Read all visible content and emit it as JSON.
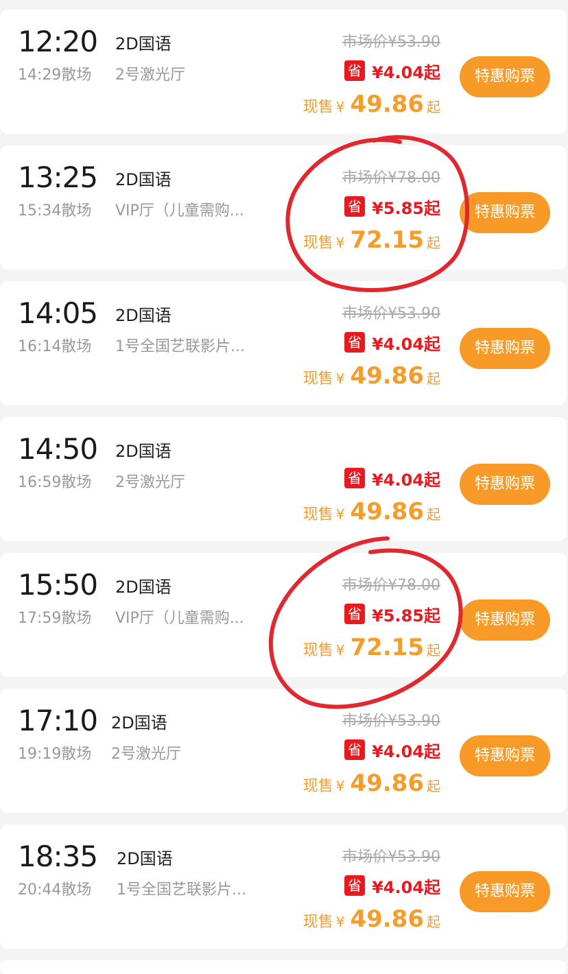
{
  "showtimes": [
    {
      "start": "12:20",
      "end": "14:29散场",
      "format": "2D国语",
      "hall": "2号激光厅",
      "market_price": "市场价¥53.90",
      "save_badge": "省",
      "save_amount": "¥4.04起",
      "now_label": "现售",
      "currency": "¥",
      "now_price": "49.86",
      "now_unit": "起",
      "button": "特惠购票"
    },
    {
      "start": "13:25",
      "end": "15:34散场",
      "format": "2D国语",
      "hall": "VIP厅（儿童需购...",
      "market_price": "市场价¥78.00",
      "save_badge": "省",
      "save_amount": "¥5.85起",
      "now_label": "现售",
      "currency": "¥",
      "now_price": "72.15",
      "now_unit": "起",
      "button": "特惠购票"
    },
    {
      "start": "14:05",
      "end": "16:14散场",
      "format": "2D国语",
      "hall": "1号全国艺联影片...",
      "market_price": "市场价¥53.90",
      "save_badge": "省",
      "save_amount": "¥4.04起",
      "now_label": "现售",
      "currency": "¥",
      "now_price": "49.86",
      "now_unit": "起",
      "button": "特惠购票"
    },
    {
      "start": "14:50",
      "end": "16:59散场",
      "format": "2D国语",
      "hall": "2号激光厅",
      "market_price": "",
      "save_badge": "省",
      "save_amount": "¥4.04起",
      "now_label": "现售",
      "currency": "¥",
      "now_price": "49.86",
      "now_unit": "起",
      "button": "特惠购票"
    },
    {
      "start": "15:50",
      "end": "17:59散场",
      "format": "2D国语",
      "hall": "VIP厅（儿童需购...",
      "market_price": "市场价¥78.00",
      "save_badge": "省",
      "save_amount": "¥5.85起",
      "now_label": "现售",
      "currency": "¥",
      "now_price": "72.15",
      "now_unit": "起",
      "button": "特惠购票"
    },
    {
      "start": "17:10",
      "end": "19:19散场",
      "format": "2D国语",
      "hall": "2号激光厅",
      "market_price": "市场价¥53.90",
      "save_badge": "省",
      "save_amount": "¥4.04起",
      "now_label": "现售",
      "currency": "¥",
      "now_price": "49.86",
      "now_unit": "起",
      "button": "特惠购票"
    },
    {
      "start": "18:35",
      "end": "20:44散场",
      "format": "2D国语",
      "hall": "1号全国艺联影片...",
      "market_price": "市场价¥53.90",
      "save_badge": "省",
      "save_amount": "¥4.04起",
      "now_label": "现售",
      "currency": "¥",
      "now_price": "49.86",
      "now_unit": "起",
      "button": "特惠购票"
    }
  ],
  "colors": {
    "background": "#f4f4f4",
    "card": "#ffffff",
    "save_red": "#e8191f",
    "price_orange": "#f59c2b",
    "button_orange": "#f89a27",
    "annotation_red": "#e0282e"
  }
}
